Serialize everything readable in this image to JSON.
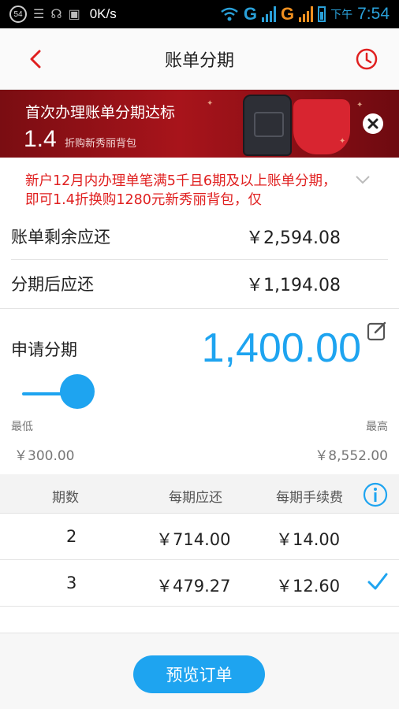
{
  "status_bar": {
    "notification_count": "54",
    "net_speed": "0K/s",
    "network_1": "G",
    "network_2": "G",
    "ampm": "下午",
    "time": "7:54"
  },
  "header": {
    "title": "账单分期",
    "back_icon": "chevron-left-icon",
    "history_icon": "clock-icon"
  },
  "banner": {
    "title": "首次办理账单分期达标",
    "discount": "1.4",
    "subtitle": "折购新秀丽背包"
  },
  "notice": {
    "text": "新户12月内办理单笔满5千且6期及以上账单分期，即可1.4折换购1280元新秀丽背包，仅"
  },
  "summary": {
    "remaining_label": "账单剩余应还",
    "remaining_value": "￥2,594.08",
    "after_label": "分期后应还",
    "after_value": "￥1,194.08"
  },
  "apply": {
    "label": "申请分期",
    "amount": "1,400.00",
    "slider_fraction": 0.13,
    "min_label": "最低",
    "max_label": "最高",
    "min_value": "￥300.00",
    "max_value": "￥8,552.00"
  },
  "table": {
    "headers": [
      "期数",
      "每期应还",
      "每期手续费"
    ],
    "rows": [
      {
        "periods": "2",
        "payment": "￥714.00",
        "fee": "￥14.00",
        "selected": false
      },
      {
        "periods": "3",
        "payment": "￥479.27",
        "fee": "￥12.60",
        "selected": true
      }
    ]
  },
  "footer": {
    "preview_label": "预览订单"
  },
  "colors": {
    "accent": "#1ea4f0",
    "notice_red": "#e02020",
    "header_red": "#e02020"
  }
}
